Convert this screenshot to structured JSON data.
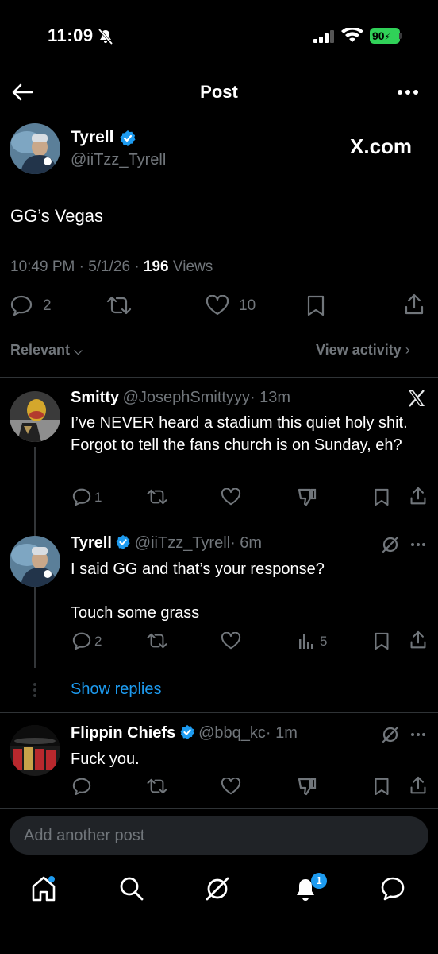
{
  "status_bar": {
    "time": "11:09",
    "battery": "90"
  },
  "header": {
    "title": "Post"
  },
  "main_post": {
    "name": "Tyrell",
    "handle": "@iiTzz_Tyrell",
    "source_label": "X.com",
    "text": "GG’s Vegas",
    "time": "10:49 PM · 5/1/26 · ",
    "views_count": "196",
    "views_label": " Views",
    "replies": "2",
    "likes": "10"
  },
  "sort": {
    "label": "Relevant",
    "view_activity": "View activity"
  },
  "replies": [
    {
      "name": "Smitty",
      "handle": "@JosephSmittyyy",
      "time": "· 13m",
      "text": "I’ve NEVER heard a stadium this quiet holy shit. Forgot to tell the fans church is on Sunday, eh?",
      "reply_count": "1"
    },
    {
      "name": "Tyrell",
      "handle": "@iiTzz_Tyrell",
      "time": "· 6m",
      "text_line1": "I said GG and that’s your response?",
      "text_line2": "Touch some grass",
      "reply_count": "2",
      "views": "5"
    },
    {
      "name": "Flippin Chiefs",
      "handle": "@bbq_kc",
      "time": "· 1m",
      "text": "Fuck you."
    }
  ],
  "show_replies": "Show replies",
  "composer": {
    "placeholder": "Add another post"
  },
  "bottom_nav": {
    "notifications_badge": "1"
  },
  "colors": {
    "accent": "#1d9bf0",
    "background": "#000000",
    "muted": "#71767b",
    "battery": "#30d158"
  },
  "icons": [
    "bell-off-icon",
    "back-icon",
    "more-icon",
    "verified-icon",
    "reply-icon",
    "repost-icon",
    "like-icon",
    "bookmark-icon",
    "share-icon",
    "grok-icon",
    "dislike-icon",
    "views-icon",
    "home-icon",
    "search-icon",
    "notifications-icon",
    "messages-icon"
  ]
}
